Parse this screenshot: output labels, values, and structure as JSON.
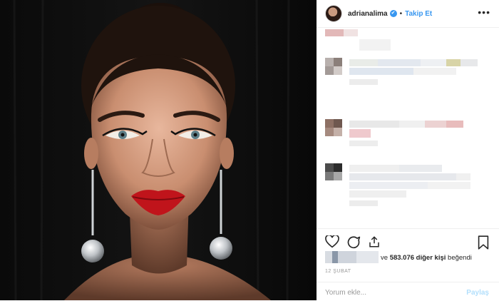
{
  "post": {
    "username": "adrianalima",
    "verified_badge": "✔",
    "separator": "•",
    "follow_label": "Takip Et",
    "more_label": "•••"
  },
  "likes": {
    "prefix": "ve",
    "count_text": "583.076 diğer kişi",
    "suffix": "beğendi"
  },
  "date": "12 ŞUBAT",
  "comment_box": {
    "placeholder": "Yorum ekle...",
    "post_label": "Paylaş"
  },
  "icons": {
    "like": "heart-icon",
    "comment": "comment-icon",
    "share": "share-icon",
    "save": "bookmark-icon",
    "verified": "verified-badge-icon",
    "more": "more-options-icon"
  },
  "colors": {
    "link_blue": "#3897f0",
    "post_disabled": "#b2dffc",
    "text": "#262626",
    "muted": "#999999",
    "lipstick": "#c0141b"
  }
}
